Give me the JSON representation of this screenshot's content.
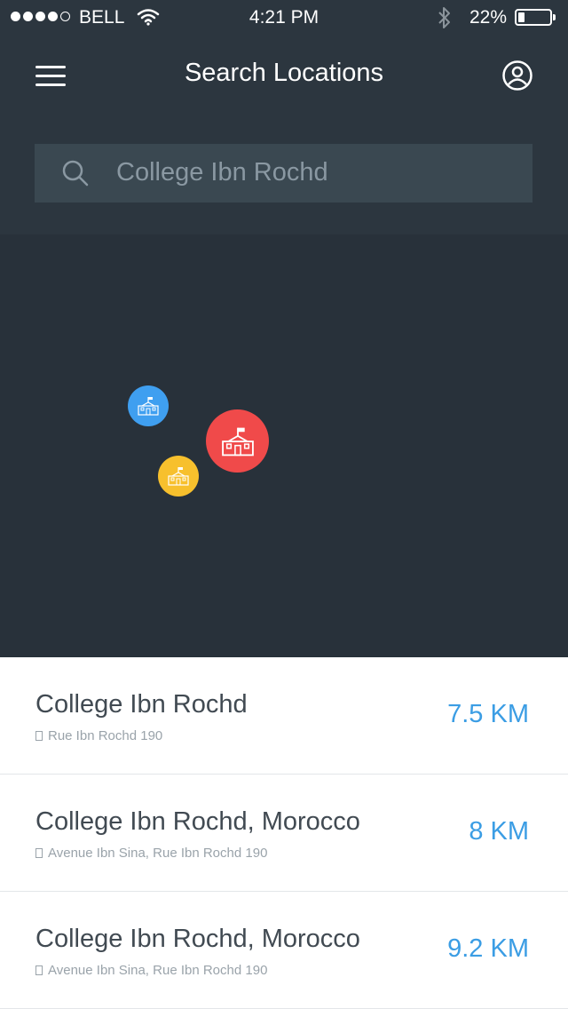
{
  "status_bar": {
    "carrier": "BELL",
    "time": "4:21 PM",
    "battery_percent": "22%",
    "battery_level": 0.22,
    "signal_bars": 4,
    "signal_total": 5
  },
  "nav": {
    "title": "Search Locations",
    "menu_icon": "hamburger-menu-icon",
    "profile_icon": "user-profile-icon"
  },
  "search": {
    "value": "College Ibn Rochd",
    "icon": "search-icon"
  },
  "map": {
    "markers": [
      {
        "color": "#3f9ff0",
        "icon": "school-building-icon"
      },
      {
        "color": "#f04a4a",
        "icon": "school-building-icon"
      },
      {
        "color": "#f7c02d",
        "icon": "school-building-icon"
      }
    ]
  },
  "results": [
    {
      "name": "College Ibn Rochd",
      "address": "Rue Ibn Rochd 190",
      "distance": "7.5 KM"
    },
    {
      "name": "College Ibn Rochd, Morocco",
      "address": "Avenue Ibn Sina, Rue Ibn Rochd 190",
      "distance": "8 KM"
    },
    {
      "name": "College Ibn Rochd, Morocco",
      "address": "Avenue Ibn Sina, Rue Ibn Rochd 190",
      "distance": "9.2 KM"
    }
  ],
  "colors": {
    "background_dark": "#28313a",
    "header": "#2c363f",
    "search_field": "#3a4851",
    "accent_distance": "#3b9de4"
  }
}
